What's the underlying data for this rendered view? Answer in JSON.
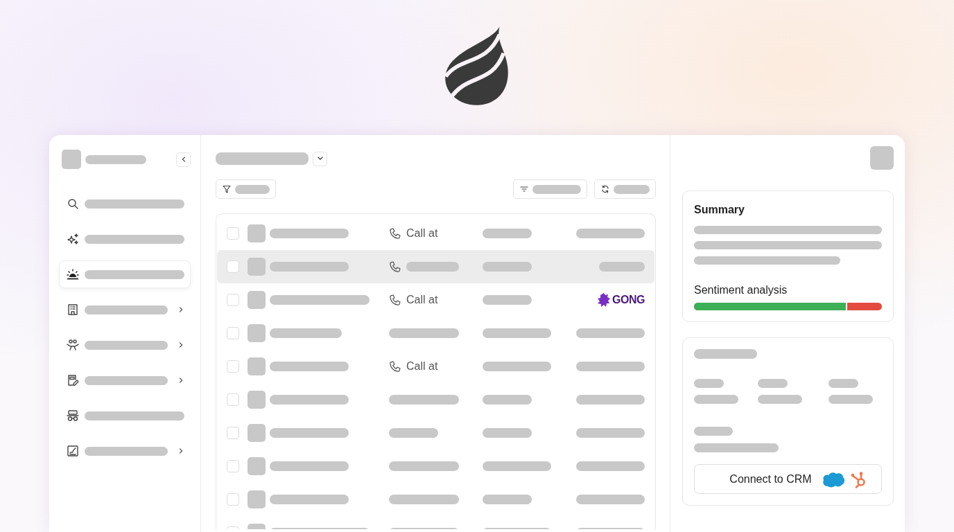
{
  "sidebar": {
    "items": [
      {
        "kind": "search",
        "expandable": false,
        "selected": false
      },
      {
        "kind": "sparkles",
        "expandable": false,
        "selected": false
      },
      {
        "kind": "sunrise",
        "expandable": false,
        "selected": true
      },
      {
        "kind": "building",
        "expandable": true,
        "selected": false
      },
      {
        "kind": "people",
        "expandable": true,
        "selected": false
      },
      {
        "kind": "note",
        "expandable": true,
        "selected": false
      },
      {
        "kind": "glasses",
        "expandable": false,
        "selected": false
      },
      {
        "kind": "chart",
        "expandable": true,
        "selected": false
      }
    ]
  },
  "table": {
    "rows": [
      {
        "checked": false,
        "selected": false,
        "call": {
          "kind": "label",
          "text": "Call at"
        }
      },
      {
        "checked": false,
        "selected": true,
        "call": {
          "kind": "pending"
        }
      },
      {
        "checked": false,
        "selected": false,
        "call": {
          "kind": "label",
          "text": "Call at"
        },
        "source": "GONG"
      },
      {
        "checked": false,
        "selected": false
      },
      {
        "checked": false,
        "selected": false,
        "call": {
          "kind": "label",
          "text": "Call at"
        }
      },
      {
        "checked": false,
        "selected": false
      },
      {
        "checked": false,
        "selected": false
      },
      {
        "checked": false,
        "selected": false
      },
      {
        "checked": false,
        "selected": false
      },
      {
        "checked": false,
        "selected": false
      }
    ]
  },
  "details": {
    "summary": {
      "title": "Summary"
    },
    "sentiment": {
      "label": "Sentiment analysis",
      "level": 0.815
    },
    "crm_button": {
      "label": "Connect to CRM"
    }
  }
}
